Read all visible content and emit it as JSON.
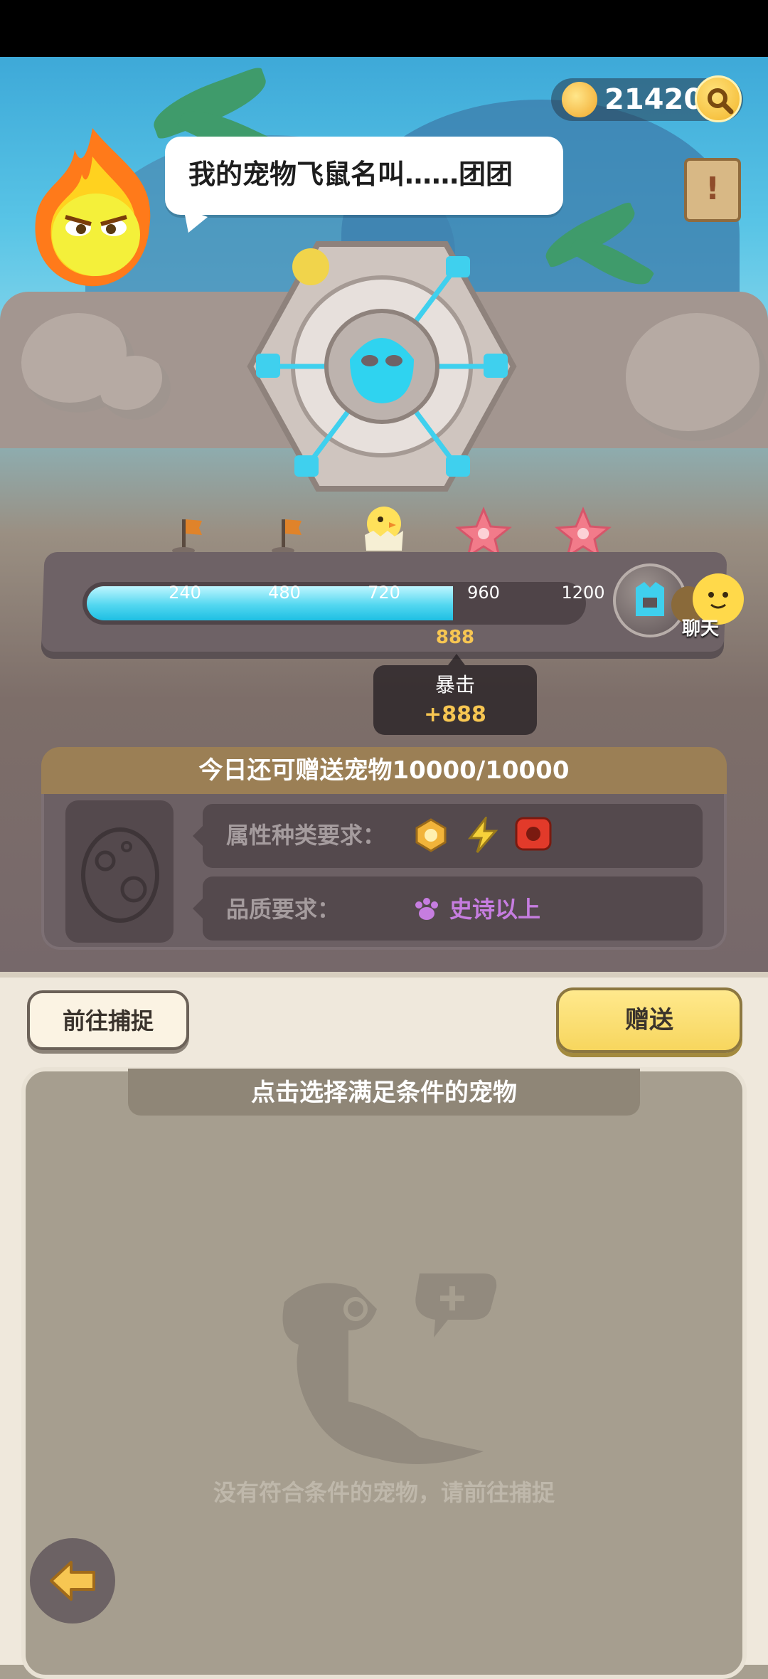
{
  "currency": {
    "amount": "21420"
  },
  "dialog": {
    "text": "我的宠物飞鼠名叫……团团"
  },
  "progress": {
    "milestones": [
      "240",
      "480",
      "720",
      "960",
      "1200"
    ],
    "current": "888",
    "max": 1200,
    "fill_fraction": 0.74
  },
  "crit": {
    "title": "暴击",
    "value": "+888"
  },
  "chat": {
    "label": "聊天"
  },
  "gift": {
    "header": "今日还可赠送宠物10000/10000",
    "attribute_label": "属性种类要求：",
    "quality_label": "品质要求：",
    "quality_value": "史诗以上"
  },
  "buttons": {
    "goto_catch": "前往捕捉",
    "send": "赠送"
  },
  "pet_list": {
    "header": "点击选择满足条件的宠物",
    "empty_message": "没有符合条件的宠物，请前往捕捉"
  },
  "colors": {
    "accent_cyan": "#3fd0ee",
    "gold": "#f7c652",
    "epic_purple": "#c67de0"
  }
}
